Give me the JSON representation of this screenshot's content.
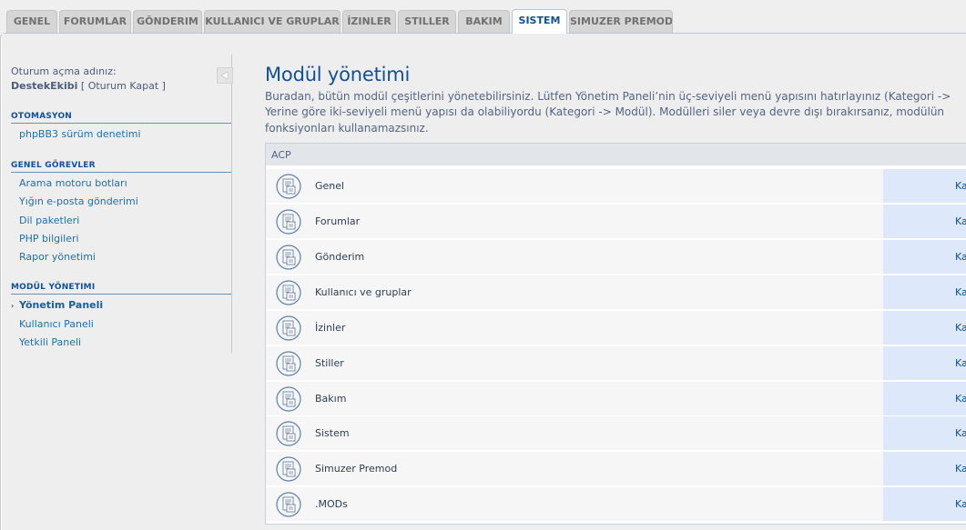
{
  "tabs": [
    {
      "label": "GENEL"
    },
    {
      "label": "FORUMLAR"
    },
    {
      "label": "GÖNDERIM"
    },
    {
      "label": "KULLANICI VE GRUPLAR"
    },
    {
      "label": "İZINLER"
    },
    {
      "label": "STILLER"
    },
    {
      "label": "BAKIM"
    },
    {
      "label": "SISTEM"
    },
    {
      "label": "SIMUZER PREMOD"
    }
  ],
  "sidebar": {
    "login_label": "Oturum açma adınız:",
    "username": "DestekEkibi",
    "logout_label": "[ Oturum Kapat ]",
    "collapse_icon": "triangle-left-icon",
    "sections": [
      {
        "title": "OTOMASYON",
        "items": [
          {
            "label": "phpBB3 sürüm denetimi"
          }
        ]
      },
      {
        "title": "GENEL GÖREVLER",
        "items": [
          {
            "label": "Arama motoru botları"
          },
          {
            "label": "Yığın e-posta gönderimi"
          },
          {
            "label": "Dil paketleri"
          },
          {
            "label": "PHP bilgileri"
          },
          {
            "label": "Rapor yönetimi"
          }
        ]
      },
      {
        "title": "MODÜL YÖNETIMI",
        "items": [
          {
            "label": "Yönetim Paneli"
          },
          {
            "label": "Kullanıcı Paneli"
          },
          {
            "label": "Yetkili Paneli"
          }
        ]
      }
    ]
  },
  "main": {
    "title": "Modül yönetimi",
    "description_lines": [
      "Buradan, bütün modül çeşitlerini yönetebilirsiniz. Lütfen Yönetim Paneli’nin üç-seviyeli menü yapısını hatırlayınız (Kategori ->",
      "Yerine göre iki-seviyeli menü yapısı da olabiliyordu (Kategori -> Modül). Modülleri siler veya devre dışı bırakırsanız, modülün",
      "fonksiyonları kullanamazsınız."
    ],
    "table_header": "ACP",
    "module_icon": "module-document-icon",
    "modules": [
      {
        "name": "Genel",
        "action": "Kapat"
      },
      {
        "name": "Forumlar",
        "action": "Kapat"
      },
      {
        "name": "Gönderim",
        "action": "Kapat"
      },
      {
        "name": "Kullanıcı ve gruplar",
        "action": "Kapat"
      },
      {
        "name": "İzinler",
        "action": "Kapat"
      },
      {
        "name": "Stiller",
        "action": "Kapat"
      },
      {
        "name": "Bakım",
        "action": "Kapat"
      },
      {
        "name": "Sistem",
        "action": "Kapat"
      },
      {
        "name": "Simuzer Premod",
        "action": "Kapat"
      },
      {
        "name": ".MODs",
        "action": "Kapat"
      }
    ]
  },
  "colors": {
    "accent": "#115098",
    "active_tab_text": "#105289",
    "action_cell": "#dde9fb"
  }
}
